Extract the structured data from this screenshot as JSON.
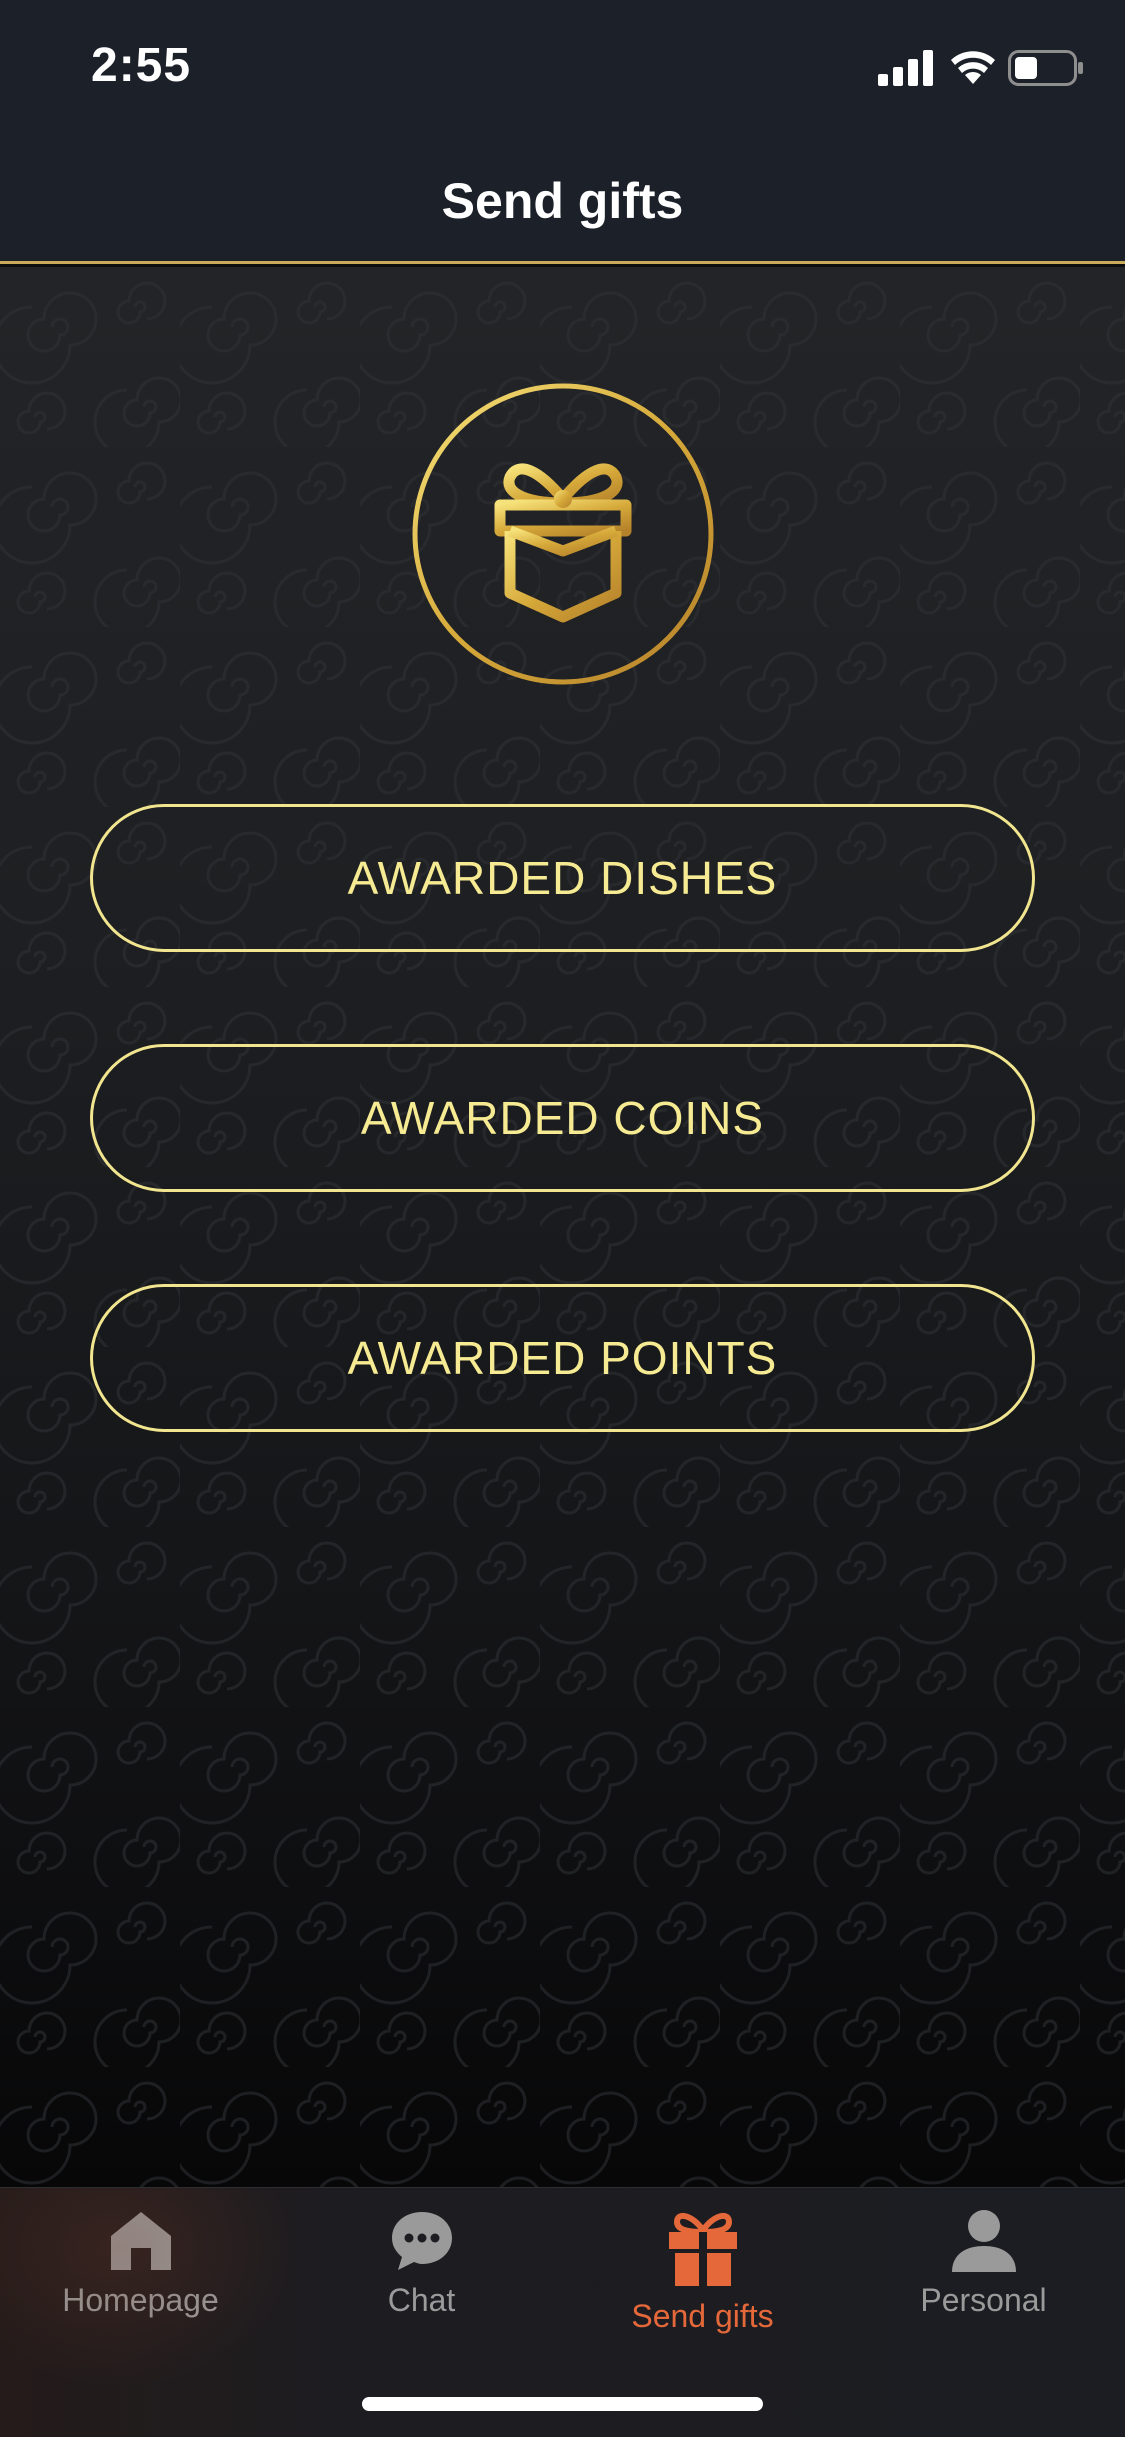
{
  "status_bar": {
    "time": "2:55",
    "icons": [
      "cellular-signal-icon",
      "wifi-icon",
      "battery-icon"
    ]
  },
  "header": {
    "title": "Send gifts"
  },
  "hero": {
    "icon": "gift-icon"
  },
  "buttons": [
    {
      "label": "AWARDED DISHES"
    },
    {
      "label": "AWARDED COINS"
    },
    {
      "label": "AWARDED POINTS"
    }
  ],
  "tab_bar": {
    "active_index": 2,
    "items": [
      {
        "label": "Homepage",
        "icon": "home-icon"
      },
      {
        "label": "Chat",
        "icon": "chat-bubble-icon"
      },
      {
        "label": "Send gifts",
        "icon": "gift-icon"
      },
      {
        "label": "Personal",
        "icon": "person-icon"
      }
    ]
  },
  "colors": {
    "accent_gold": "#f2e58f",
    "tab_active": "#e5683a",
    "tab_inactive": "#9a9a9a",
    "header_bg": "#1c2029"
  }
}
